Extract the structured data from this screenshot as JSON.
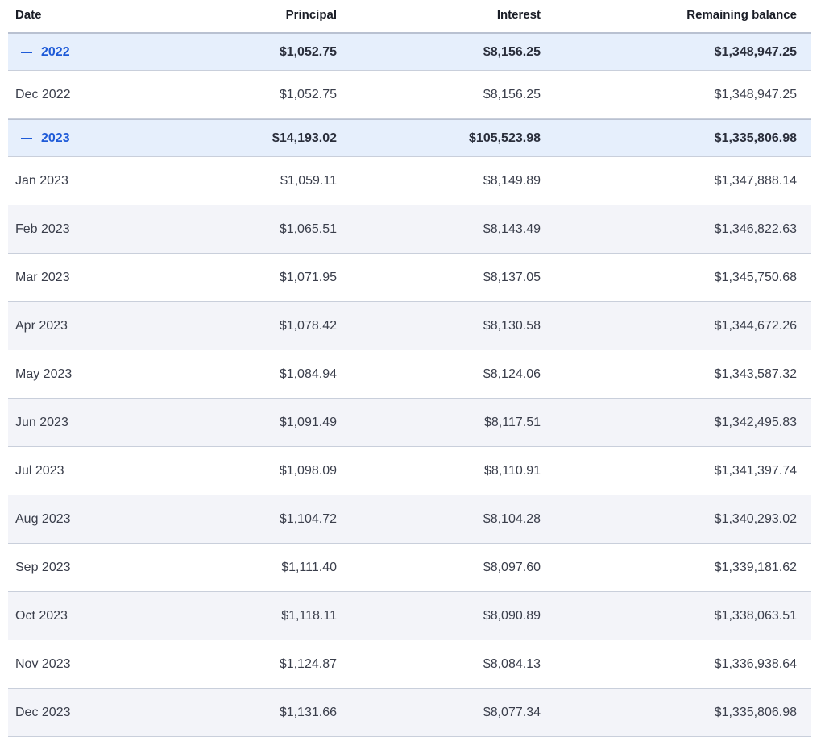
{
  "columns": {
    "date": "Date",
    "principal": "Principal",
    "interest": "Interest",
    "balance": "Remaining balance"
  },
  "groups": [
    {
      "year": "2022",
      "principal": "$1,052.75",
      "interest": "$8,156.25",
      "balance": "$1,348,947.25",
      "icon": "minus-icon",
      "rows": [
        {
          "date": "Dec 2022",
          "principal": "$1,052.75",
          "interest": "$8,156.25",
          "balance": "$1,348,947.25"
        }
      ]
    },
    {
      "year": "2023",
      "principal": "$14,193.02",
      "interest": "$105,523.98",
      "balance": "$1,335,806.98",
      "icon": "minus-icon",
      "rows": [
        {
          "date": "Jan 2023",
          "principal": "$1,059.11",
          "interest": "$8,149.89",
          "balance": "$1,347,888.14"
        },
        {
          "date": "Feb 2023",
          "principal": "$1,065.51",
          "interest": "$8,143.49",
          "balance": "$1,346,822.63"
        },
        {
          "date": "Mar 2023",
          "principal": "$1,071.95",
          "interest": "$8,137.05",
          "balance": "$1,345,750.68"
        },
        {
          "date": "Apr 2023",
          "principal": "$1,078.42",
          "interest": "$8,130.58",
          "balance": "$1,344,672.26"
        },
        {
          "date": "May 2023",
          "principal": "$1,084.94",
          "interest": "$8,124.06",
          "balance": "$1,343,587.32"
        },
        {
          "date": "Jun 2023",
          "principal": "$1,091.49",
          "interest": "$8,117.51",
          "balance": "$1,342,495.83"
        },
        {
          "date": "Jul 2023",
          "principal": "$1,098.09",
          "interest": "$8,110.91",
          "balance": "$1,341,397.74"
        },
        {
          "date": "Aug 2023",
          "principal": "$1,104.72",
          "interest": "$8,104.28",
          "balance": "$1,340,293.02"
        },
        {
          "date": "Sep 2023",
          "principal": "$1,111.40",
          "interest": "$8,097.60",
          "balance": "$1,339,181.62"
        },
        {
          "date": "Oct 2023",
          "principal": "$1,118.11",
          "interest": "$8,090.89",
          "balance": "$1,338,063.51"
        },
        {
          "date": "Nov 2023",
          "principal": "$1,124.87",
          "interest": "$8,084.13",
          "balance": "$1,336,938.64"
        },
        {
          "date": "Dec 2023",
          "principal": "$1,131.66",
          "interest": "$8,077.34",
          "balance": "$1,335,806.98"
        }
      ]
    }
  ],
  "colors": {
    "accent": "#1f5bd8",
    "group_bg": "#e6effc",
    "alt_row_bg": "#f3f4f9",
    "border": "#c9cfdb"
  }
}
